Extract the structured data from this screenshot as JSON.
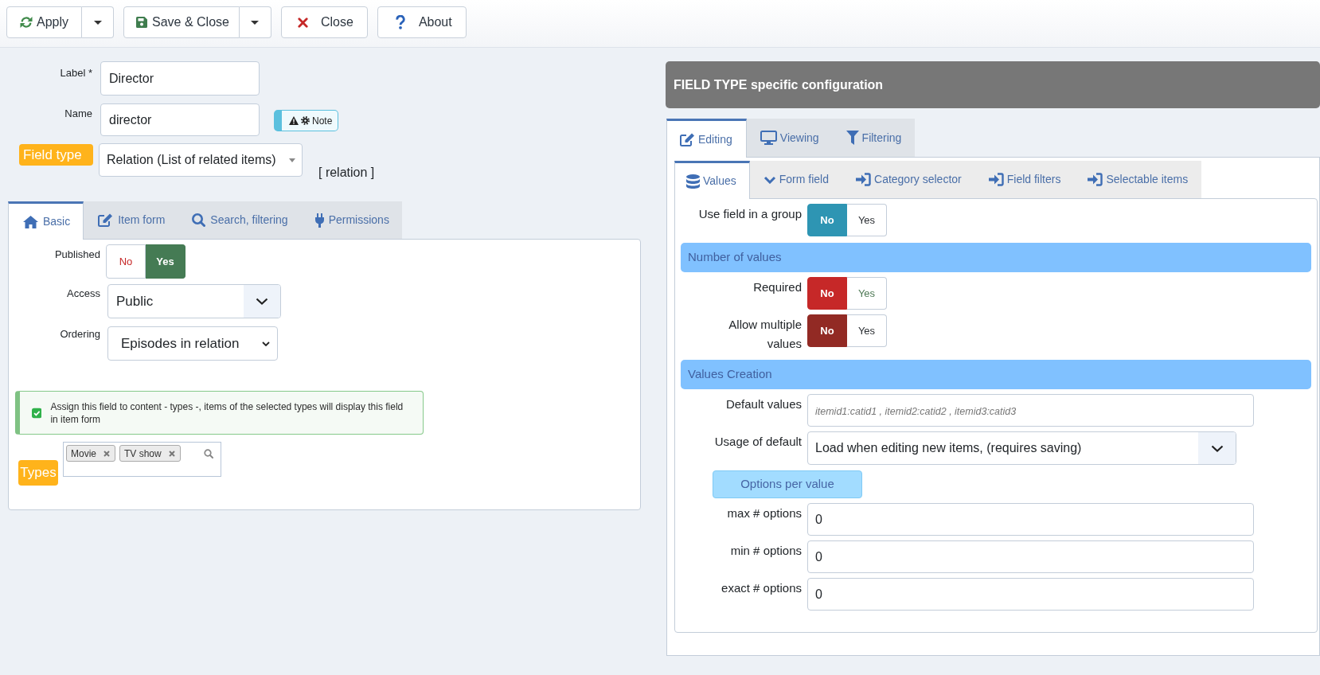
{
  "toolbar": {
    "buttons": [
      {
        "kind": "apply",
        "label": "Apply",
        "dropdown": true
      },
      {
        "kind": "save",
        "label": "Save & Close",
        "dropdown": true
      },
      {
        "kind": "close",
        "label": "Close",
        "dropdown": false
      },
      {
        "kind": "about",
        "label": "About",
        "dropdown": false
      }
    ]
  },
  "field": {
    "label_field": {
      "label": "Label *",
      "value": "Director"
    },
    "name_field": {
      "label": "Name",
      "value": "director",
      "note": "Note"
    },
    "field_type": {
      "label": "Field type",
      "value": "Relation (List of related items)",
      "type_code": "[ relation ]"
    }
  },
  "left_tabs": [
    {
      "kind": "basic",
      "label": "Basic",
      "selected": true
    },
    {
      "kind": "form",
      "label": "Item form",
      "selected": false
    },
    {
      "kind": "search",
      "label": "Search, filtering",
      "selected": false
    },
    {
      "kind": "permissions",
      "label": "Permissions",
      "selected": false
    }
  ],
  "basic": {
    "published": {
      "label": "Published",
      "options": [
        {
          "label": "No",
          "selected": false,
          "color": "#c62828"
        },
        {
          "label": "Yes",
          "selected": true,
          "color": "#457b54"
        }
      ]
    },
    "access": {
      "label": "Access",
      "value": "Public"
    },
    "ordering": {
      "label": "Ordering",
      "value": "Episodes in relation"
    },
    "notice": "Assign this field to content - types -, items of the selected types will display this field in item form",
    "types": {
      "label": "Types",
      "tags": [
        "Movie",
        "TV show"
      ]
    }
  },
  "config": {
    "title": "FIELD TYPE specific configuration",
    "tabs": [
      {
        "kind": "edit",
        "label": "Editing",
        "selected": true
      },
      {
        "kind": "view",
        "label": "Viewing",
        "selected": false
      },
      {
        "kind": "filter",
        "label": "Filtering",
        "selected": false
      }
    ],
    "subtabs": [
      {
        "kind": "values",
        "label": "Values",
        "selected": true
      },
      {
        "kind": "field",
        "label": "Form field",
        "selected": false
      },
      {
        "kind": "link",
        "label": "Category selector",
        "selected": false
      },
      {
        "kind": "link",
        "label": "Field filters",
        "selected": false
      },
      {
        "kind": "link",
        "label": "Selectable items",
        "selected": false
      }
    ],
    "rows": [
      {
        "kind": "toggle",
        "label": "Use field in a group",
        "options": [
          {
            "label": "No",
            "selected": true,
            "color": "#2e95b3"
          },
          {
            "label": "Yes",
            "selected": false,
            "color": "#2b2f33"
          }
        ]
      },
      {
        "kind": "section",
        "label": "Number of values"
      },
      {
        "kind": "toggle",
        "label": "Required",
        "options": [
          {
            "label": "No",
            "selected": true,
            "color": "#c62828"
          },
          {
            "label": "Yes",
            "selected": false,
            "color": "#4f7a56"
          }
        ]
      },
      {
        "kind": "toggle",
        "label": "Allow multiple values",
        "options": [
          {
            "label": "No",
            "selected": true,
            "color": "#922a24"
          },
          {
            "label": "Yes",
            "selected": false,
            "color": "#2b2f33"
          }
        ]
      },
      {
        "kind": "section",
        "label": "Values Creation"
      },
      {
        "kind": "input",
        "label": "Default values",
        "placeholder": "itemid1:catid1 , itemid2:catid2 , itemid3:catid3"
      },
      {
        "kind": "select",
        "label": "Usage of default",
        "value": "Load when editing new items, (requires saving)"
      },
      {
        "kind": "subheading",
        "label": "Options per value"
      },
      {
        "kind": "input",
        "label": "max # options",
        "value": "0"
      },
      {
        "kind": "input",
        "label": "min # options",
        "value": "0"
      },
      {
        "kind": "input",
        "label": "exact # options",
        "value": "0"
      }
    ]
  }
}
